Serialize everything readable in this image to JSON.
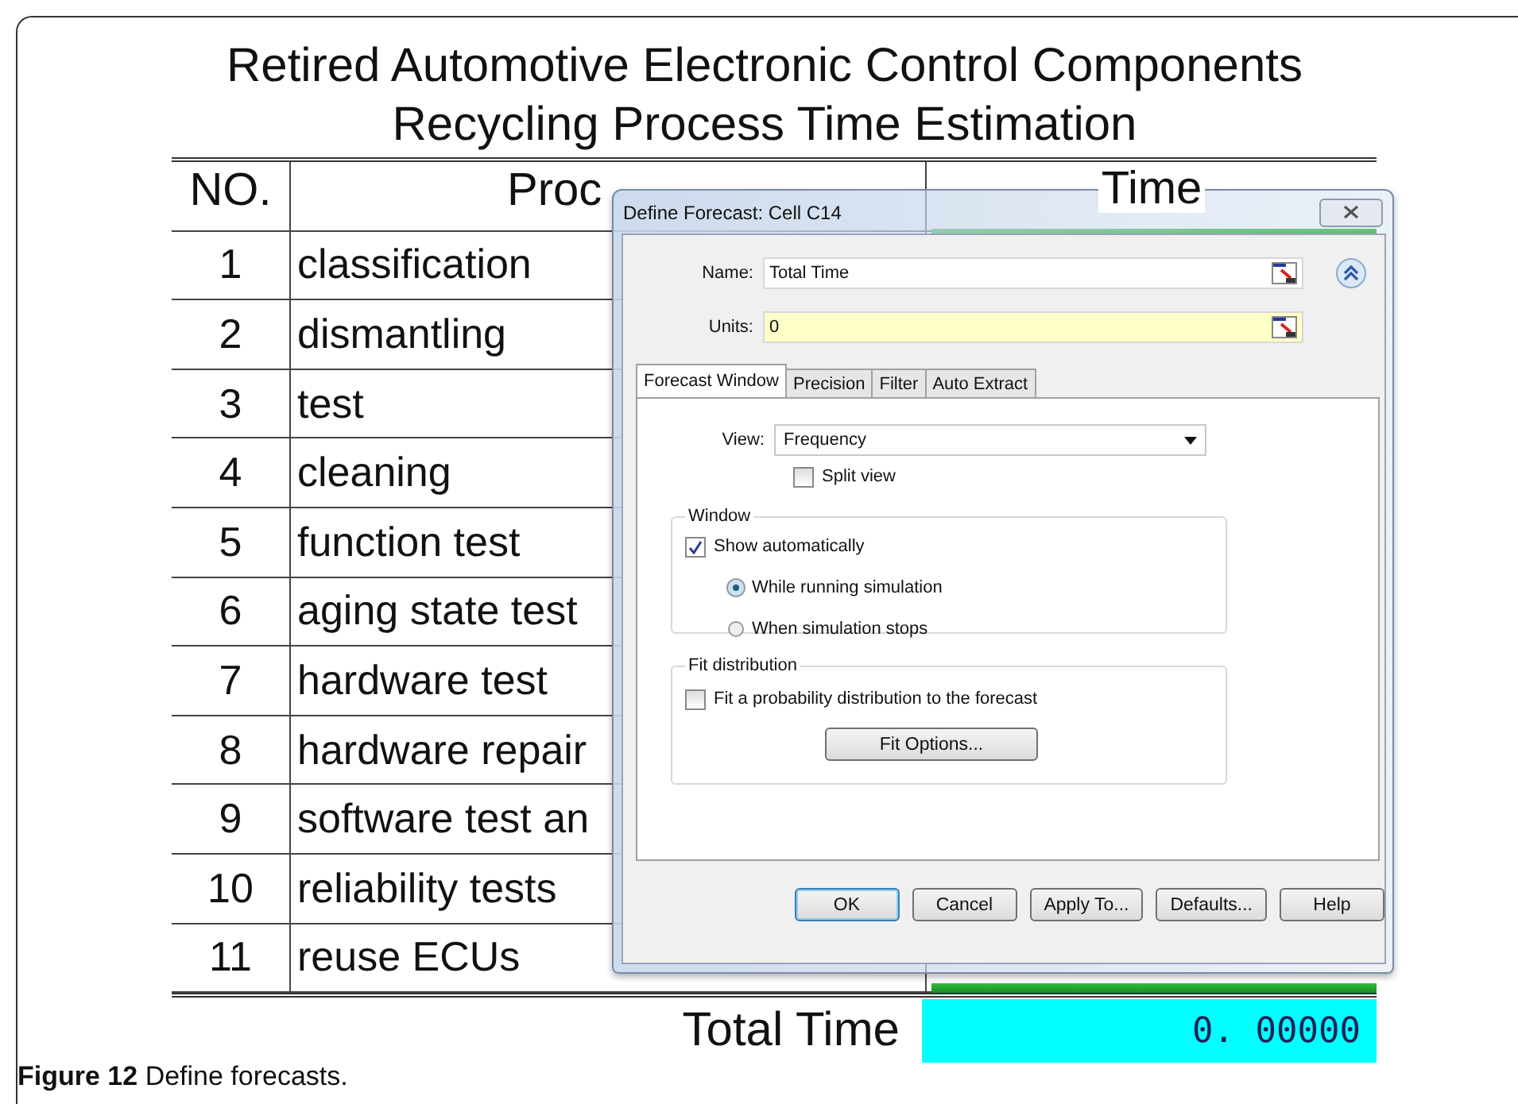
{
  "sheet": {
    "title_lines": [
      "Retired Automotive Electronic Control Components",
      "Recycling Process Time Estimation"
    ],
    "columns": [
      "NO.",
      "Proc",
      "Time"
    ],
    "rows": [
      {
        "no": "1",
        "process": "classification"
      },
      {
        "no": "2",
        "process": "dismantling"
      },
      {
        "no": "3",
        "process": "test"
      },
      {
        "no": "4",
        "process": "cleaning"
      },
      {
        "no": "5",
        "process": "function test"
      },
      {
        "no": "6",
        "process": "aging state test"
      },
      {
        "no": "7",
        "process": "hardware test"
      },
      {
        "no": "8",
        "process": "hardware repair"
      },
      {
        "no": "9",
        "process": "software test an"
      },
      {
        "no": "10",
        "process": "reliability tests"
      },
      {
        "no": "11",
        "process": "reuse ECUs"
      }
    ],
    "total": {
      "label": "Total Time",
      "value": "0. 00000"
    }
  },
  "dialog": {
    "title": "Define Forecast: Cell C14",
    "name": {
      "label": "Name:",
      "value": "Total Time"
    },
    "units": {
      "label": "Units:",
      "value": "0"
    },
    "tabs": [
      {
        "label": "Forecast Window",
        "selected": true
      },
      {
        "label": "Precision",
        "selected": false
      },
      {
        "label": "Filter",
        "selected": false
      },
      {
        "label": "Auto Extract",
        "selected": false
      }
    ],
    "view": {
      "label": "View:",
      "value": "Frequency"
    },
    "split_view": {
      "label": "Split view",
      "checked": false
    },
    "window_group": {
      "title": "Window",
      "show_automatically": {
        "label": "Show automatically",
        "checked": true
      },
      "options": [
        {
          "label": "While running simulation",
          "selected": true
        },
        {
          "label": "When simulation stops",
          "selected": false
        }
      ]
    },
    "fit_group": {
      "title": "Fit distribution",
      "fit": {
        "label": "Fit a probability distribution to the forecast",
        "checked": false
      },
      "button": "Fit Options..."
    },
    "buttons": [
      {
        "label": "OK",
        "default": true
      },
      {
        "label": "Cancel",
        "default": false
      },
      {
        "label": "Apply To...",
        "default": false
      },
      {
        "label": "Defaults...",
        "default": false
      },
      {
        "label": "Help",
        "default": false
      }
    ]
  },
  "caption": "**Figure 12** Define forecasts."
}
